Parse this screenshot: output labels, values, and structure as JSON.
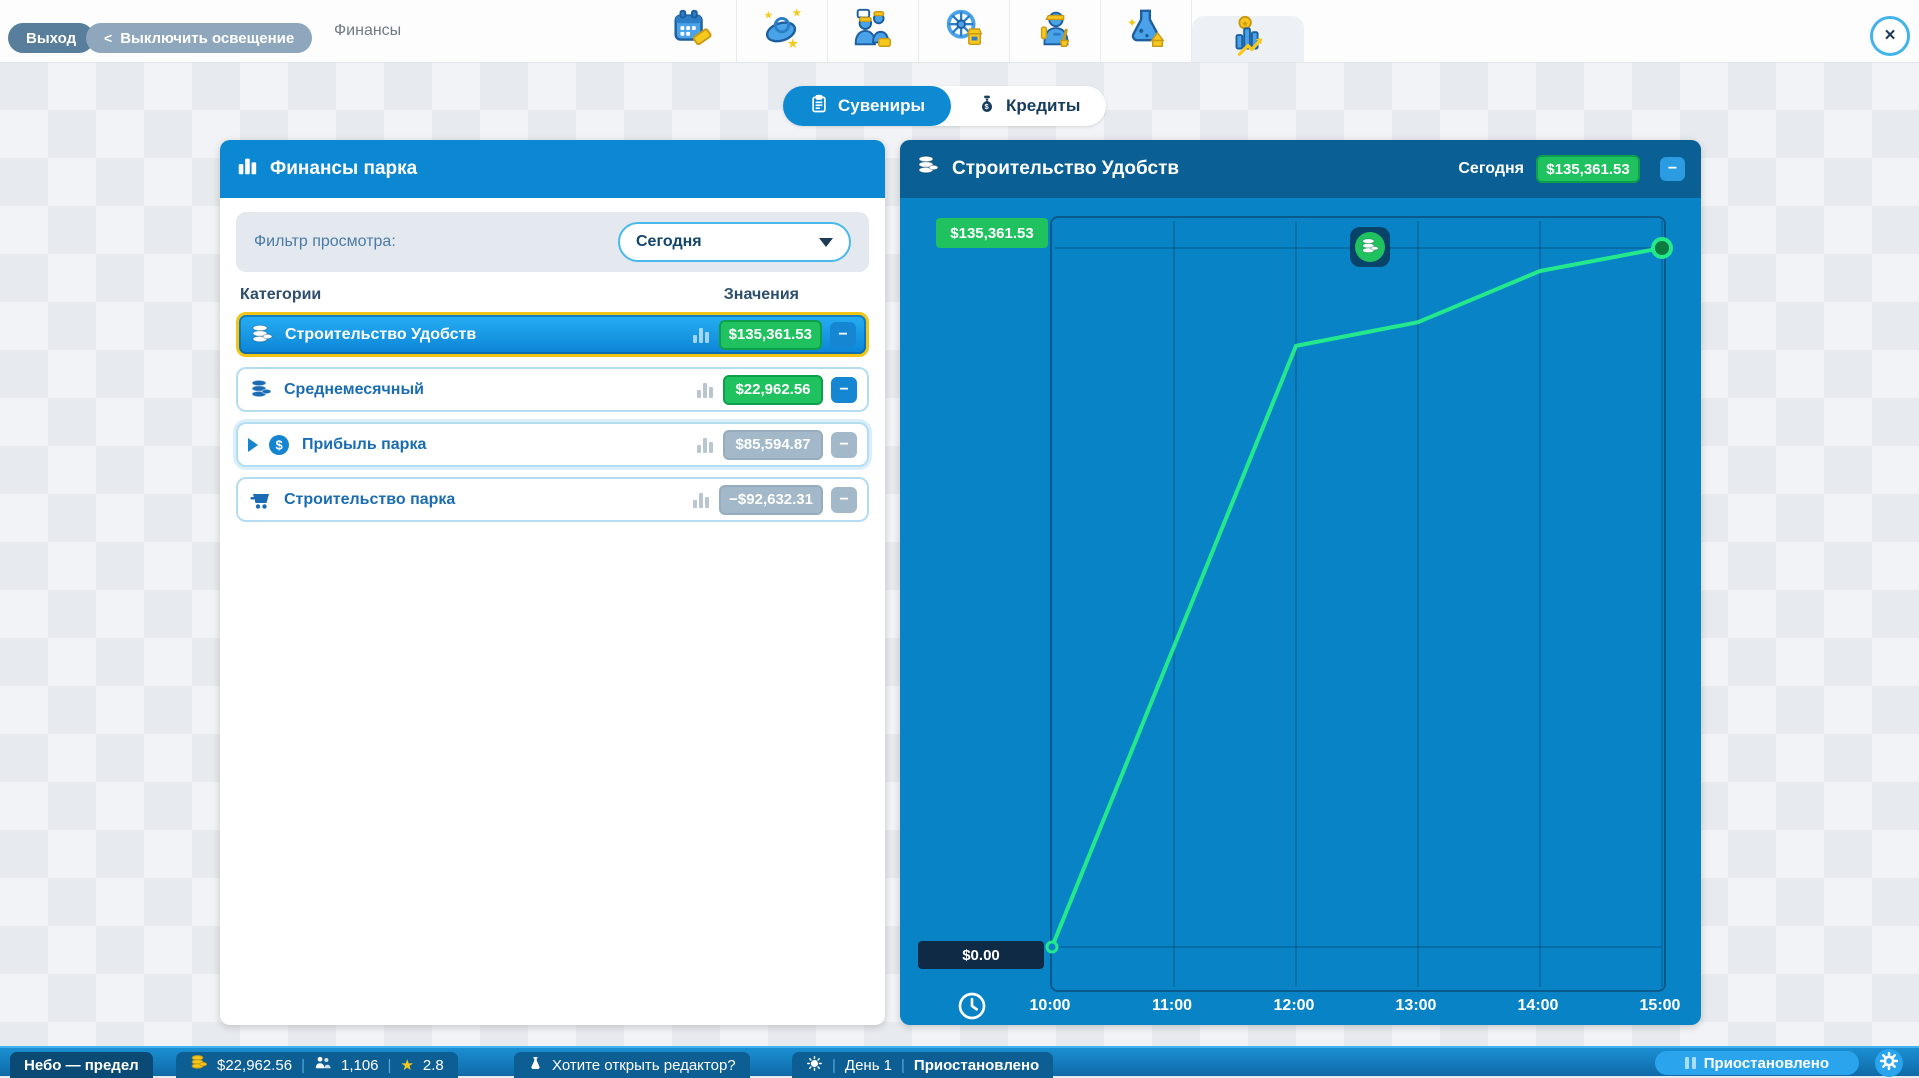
{
  "glyphs": {
    "minus": "−",
    "close": "×",
    "chevron_left": "<",
    "star": "★",
    "separator": "|"
  },
  "topbar": {
    "exit_label": "Выход",
    "lighting_label": "Выключить освещение",
    "breadcrumb": "Финансы",
    "toolbar_icons": [
      "calendar-ticket-icon",
      "coaster-icon",
      "guests-icon",
      "ferris-wheel-shop-icon",
      "staff-icon",
      "research-flask-icon",
      "finances-chart-icon"
    ],
    "active_toolbar_tab": "finances-chart-icon"
  },
  "tabs": {
    "items": [
      {
        "label": "Сувениры",
        "icon": "receipt-icon",
        "active": true
      },
      {
        "label": "Кредиты",
        "icon": "money-bag-icon",
        "active": false
      }
    ]
  },
  "finance_panel": {
    "title": "Финансы парка",
    "filter_label": "Фильтр просмотра:",
    "filter_value": "Сегодня",
    "columns": {
      "categories": "Категории",
      "values": "Значения"
    },
    "rows": [
      {
        "label": "Строительство Удобств",
        "value": "$135,361.53",
        "icon": "coins-stack-icon",
        "selected": true,
        "value_style": "green"
      },
      {
        "label": "Среднемесячный",
        "value": "$22,962.56",
        "icon": "coins-stack-icon",
        "selected": false,
        "value_style": "green"
      },
      {
        "label": "Прибыль парка",
        "value": "$85,594.87",
        "icon": "dollar-coin-icon",
        "expandable": true,
        "selected": false,
        "value_style": "gray"
      },
      {
        "label": "Строительство парка",
        "value": "−$92,632.31",
        "icon": "minecart-icon",
        "selected": false,
        "value_style": "gray"
      }
    ]
  },
  "chart_panel": {
    "title": "Строительство Удобств",
    "period_label": "Сегодня",
    "value_badge": "$135,361.53",
    "y_max_label": "$135,361.53",
    "y_min_label": "$0.00"
  },
  "chart_data": {
    "type": "line",
    "title": "Строительство Удобств",
    "series_name": "Строительство Удобств",
    "x_ticks": [
      "10:00",
      "11:00",
      "12:00",
      "13:00",
      "14:00",
      "15:00"
    ],
    "tlim": [
      10,
      15
    ],
    "ylim": [
      0,
      135361.53
    ],
    "points": [
      {
        "t": 10,
        "v": 0
      },
      {
        "t": 11,
        "v": 58200
      },
      {
        "t": 12,
        "v": 116400
      },
      {
        "t": 13,
        "v": 121000
      },
      {
        "t": 14,
        "v": 130900
      },
      {
        "t": 15,
        "v": 135361.53
      }
    ],
    "grid": "hour verticals + min/max horizontals",
    "legend_position": "top-inside",
    "line_color": "#23e98c",
    "end_dot_fill": "#0d7a3e",
    "background": "#0883c6"
  },
  "status_bar": {
    "park_name": "Небо — предел",
    "money": "$22,962.56",
    "guests": "1,106",
    "rating": "2.8",
    "editor_hint": "Хотите открыть редактор?",
    "day": "День 1",
    "state": "Приостановлено",
    "pause_button": "Приостановлено"
  }
}
